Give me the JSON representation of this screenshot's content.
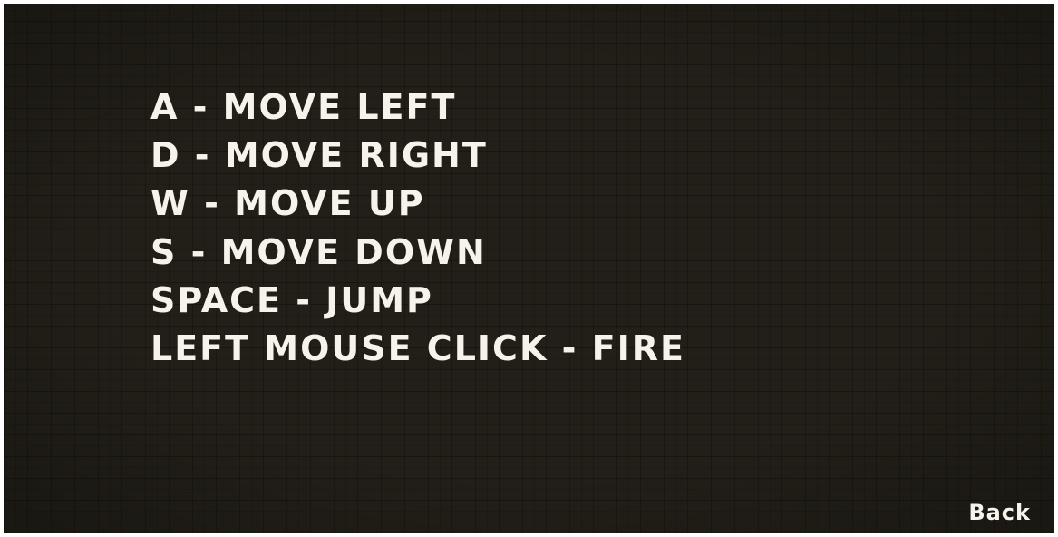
{
  "controls": {
    "lines": [
      "A - MOVE LEFT",
      "D - MOVE RIGHT",
      "W - MOVE UP",
      "S - MOVE DOWN",
      "SPACE - JUMP",
      "LEFT MOUSE CLICK - FIRE"
    ]
  },
  "navigation": {
    "back_label": "Back"
  },
  "colors": {
    "background": "#221f18",
    "text": "#f5f3ea"
  }
}
